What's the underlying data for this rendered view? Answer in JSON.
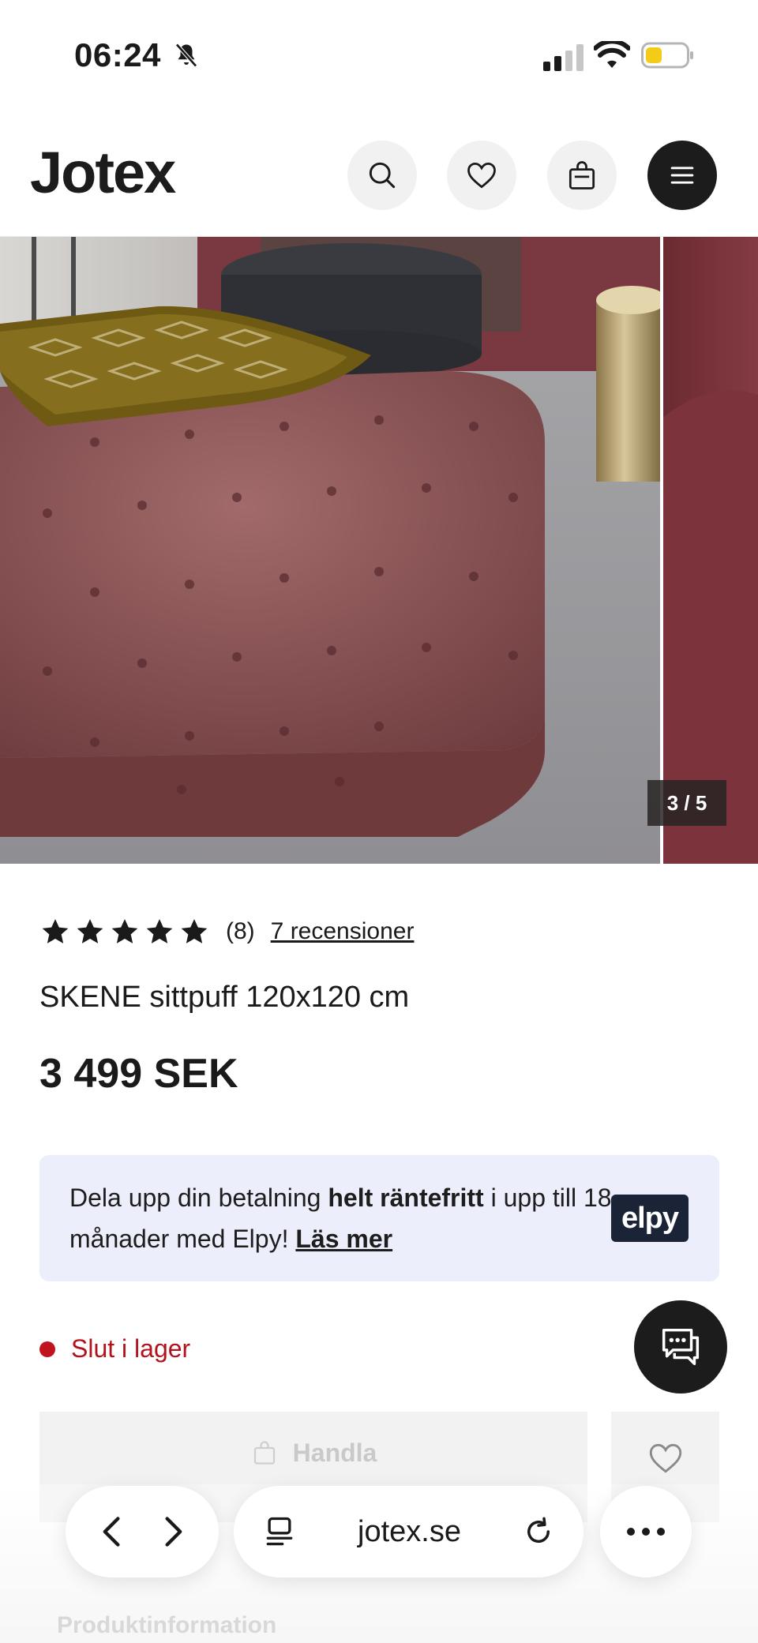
{
  "status_bar": {
    "time": "06:24"
  },
  "header": {
    "logo": "Jotex",
    "icons": [
      "search-icon",
      "heart-icon",
      "shopping-bag-icon",
      "menu-icon"
    ]
  },
  "gallery": {
    "counter": "3 / 5"
  },
  "product": {
    "rating": {
      "stars": 5,
      "count": "(8)",
      "reviews_link": "7 recensioner"
    },
    "title": "SKENE sittpuff 120x120 cm",
    "price": "3 499 SEK"
  },
  "elpy": {
    "text_before": "Dela upp din betalning ",
    "text_bold": "helt räntefritt",
    "text_after": " i upp till 18 månader med Elpy! ",
    "link": "Läs mer",
    "logo": "elpy"
  },
  "stock": {
    "status": "Slut i lager",
    "color": "#c1121f"
  },
  "actions": {
    "buy_label": "Handla"
  },
  "section": {
    "product_info": "Produktinformation"
  },
  "browser": {
    "url": "jotex.se"
  }
}
